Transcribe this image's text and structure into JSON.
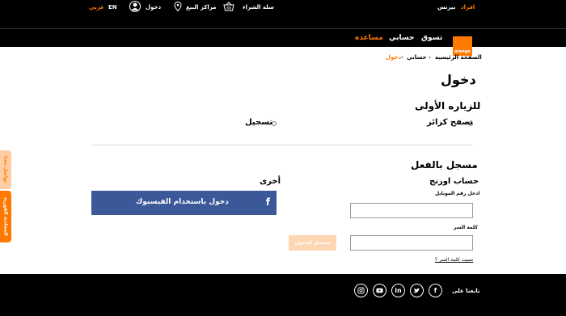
{
  "topbar": {
    "arabic": "عربي",
    "english": "EN",
    "login": "دخول",
    "stores": "مراكز البيع",
    "cart": "سلة الشراء",
    "business": "بيزنس",
    "individuals": "افراد"
  },
  "nav": {
    "help": "مساعدة",
    "account": "حسابي",
    "shop": "تسوق",
    "logo_text": "orange"
  },
  "breadcrumb": {
    "home": "الصفحة الرئيسية",
    "account": "حسابي",
    "current": "دخول",
    "sep": "›"
  },
  "page": {
    "title": "دخول",
    "first_visit": "للزياره الأولى",
    "visitor_option": "تصفح كزائر",
    "register_option": "تسجيل",
    "registered": "مسجل بالفعل",
    "orange_account": "حساب اورنج",
    "other": "أخرى",
    "mobile_label": "ادخل رقم الموبايل",
    "password_label": "كلمة السر",
    "login_button": "تسجيل الدخول",
    "forgot_password": "نسيت كلمة السر ؟",
    "facebook_button": "دخول باستخدام الفيسبوك",
    "facebook_glyph": "f"
  },
  "side_tabs": {
    "contact": "تواصل معنا",
    "chat": "المحادثة الفورية"
  },
  "footer": {
    "follow_us": "تابعنا على",
    "social": [
      "facebook-icon",
      "twitter-icon",
      "linkedin-icon",
      "youtube-icon",
      "instagram-icon"
    ]
  },
  "colors": {
    "accent": "#ff7900",
    "facebook": "#3b5998",
    "disabled_button": "#ffd6b3"
  }
}
